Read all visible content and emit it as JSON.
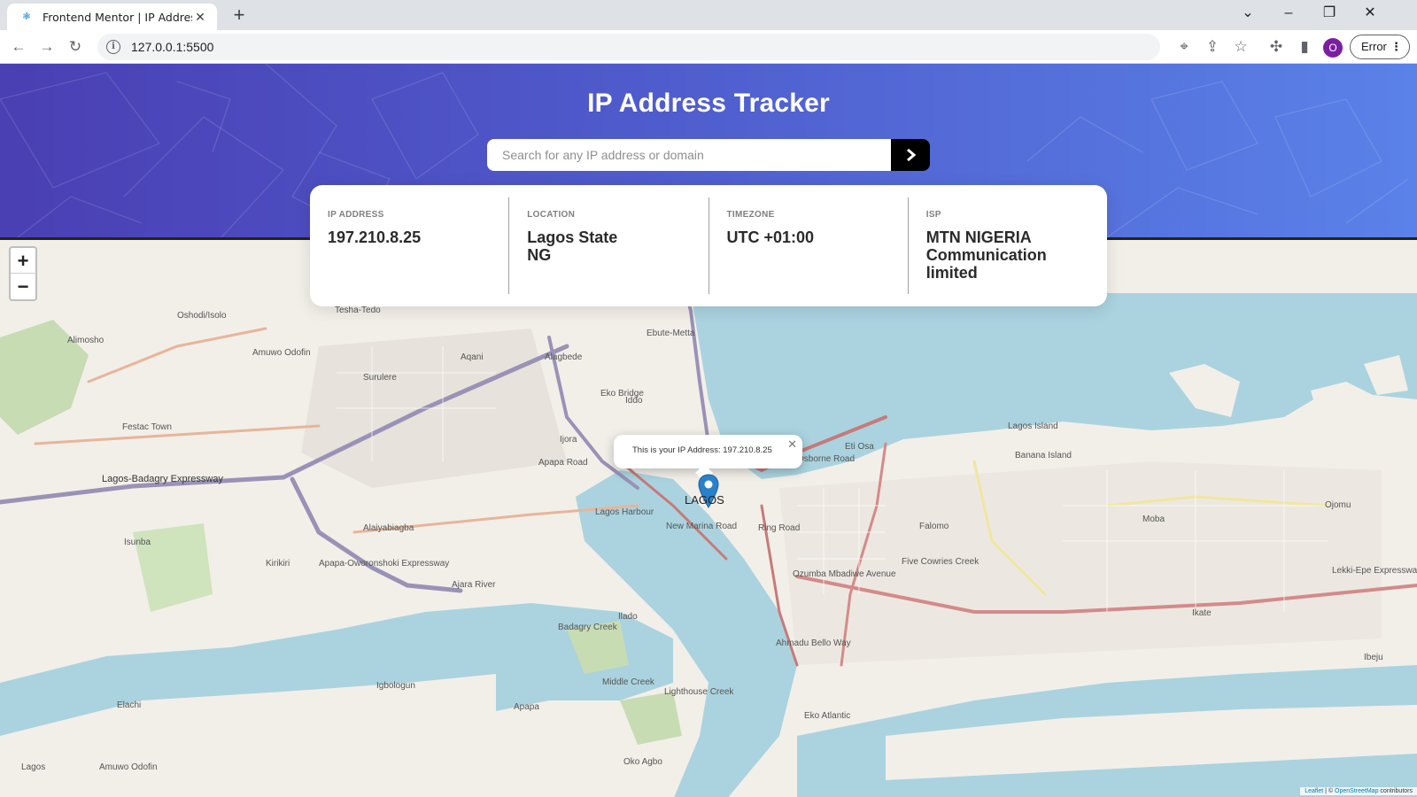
{
  "browser": {
    "tab_title": "Frontend Mentor | IP Address Tracker",
    "url": "127.0.0.1:5500",
    "profile_initial": "O",
    "error_chip": "Error"
  },
  "hero": {
    "title": "IP Address Tracker",
    "search_placeholder": "Search for any IP address or domain"
  },
  "info": [
    {
      "label": "IP ADDRESS",
      "value": "197.210.8.25"
    },
    {
      "label": "LOCATION",
      "value": "Lagos State\nNG"
    },
    {
      "label": "TIMEZONE",
      "value": "UTC +01:00"
    },
    {
      "label": "ISP",
      "value": "MTN NIGERIA\nCommunication\nlimited"
    }
  ],
  "map": {
    "popup_text": "This is your IP Address: 197.210.8.25",
    "marker_label": "LAGOS",
    "attribution_leaflet": "Leaflet",
    "attribution_osm": "OpenStreetMap",
    "attribution_tail": "contributors",
    "labels": [
      "Lagos-Badagry Expressway",
      "Apapa-Oworonshoki Expressway",
      "Festac Town",
      "Alaiyabiagba",
      "Isunba",
      "Kirikiri",
      "Ajara River",
      "Ilado",
      "Badagry Creek",
      "Igbologun",
      "Elachi",
      "Apapa",
      "Middle Creek",
      "Lighthouse Creek",
      "Amuwo Odofin",
      "Eti Osa",
      "Eko Atlantic",
      "Ozumba Mbadiwe Avenue",
      "Five Cowries Creek",
      "Falomo",
      "Lagos Island",
      "Banana Island",
      "Moba",
      "Ojomu",
      "Ikate",
      "Lekki-Epe Expressway",
      "Ibeju",
      "Ahmadu Bello Way",
      "New Marina Road",
      "Ring Road",
      "Osborne Road",
      "Surulere",
      "Aqani",
      "Alagbede",
      "Ebute-Metta",
      "Ijora",
      "Iddo",
      "Eko Bridge",
      "Apapa Road",
      "Tesha-Tedo",
      "Alimosho",
      "Oshodi/Isolo",
      "Lagos Harbour",
      "Oko Agbo",
      "Lagos",
      "Amuwo Odofin"
    ]
  }
}
